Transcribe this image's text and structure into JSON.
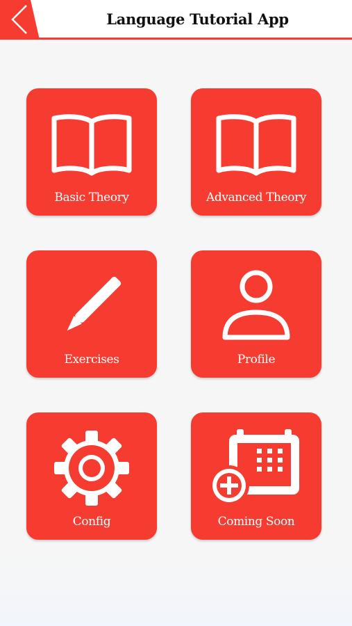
{
  "header": {
    "title": "Language Tutorial App",
    "back_icon": "chevron-left-icon"
  },
  "menu": {
    "items": [
      {
        "label": "Basic Theory",
        "icon": "open-book-icon"
      },
      {
        "label": "Advanced Theory",
        "icon": "open-book-icon"
      },
      {
        "label": "Exercises",
        "icon": "pencil-icon"
      },
      {
        "label": "Profile",
        "icon": "user-icon"
      },
      {
        "label": "Config",
        "icon": "gear-icon"
      },
      {
        "label": "Coming Soon",
        "icon": "calendar-add-icon"
      }
    ]
  },
  "colors": {
    "accent": "#f63b31",
    "tile_text": "#ffffff",
    "title_text": "#111111",
    "background": "#f6f6f6"
  }
}
